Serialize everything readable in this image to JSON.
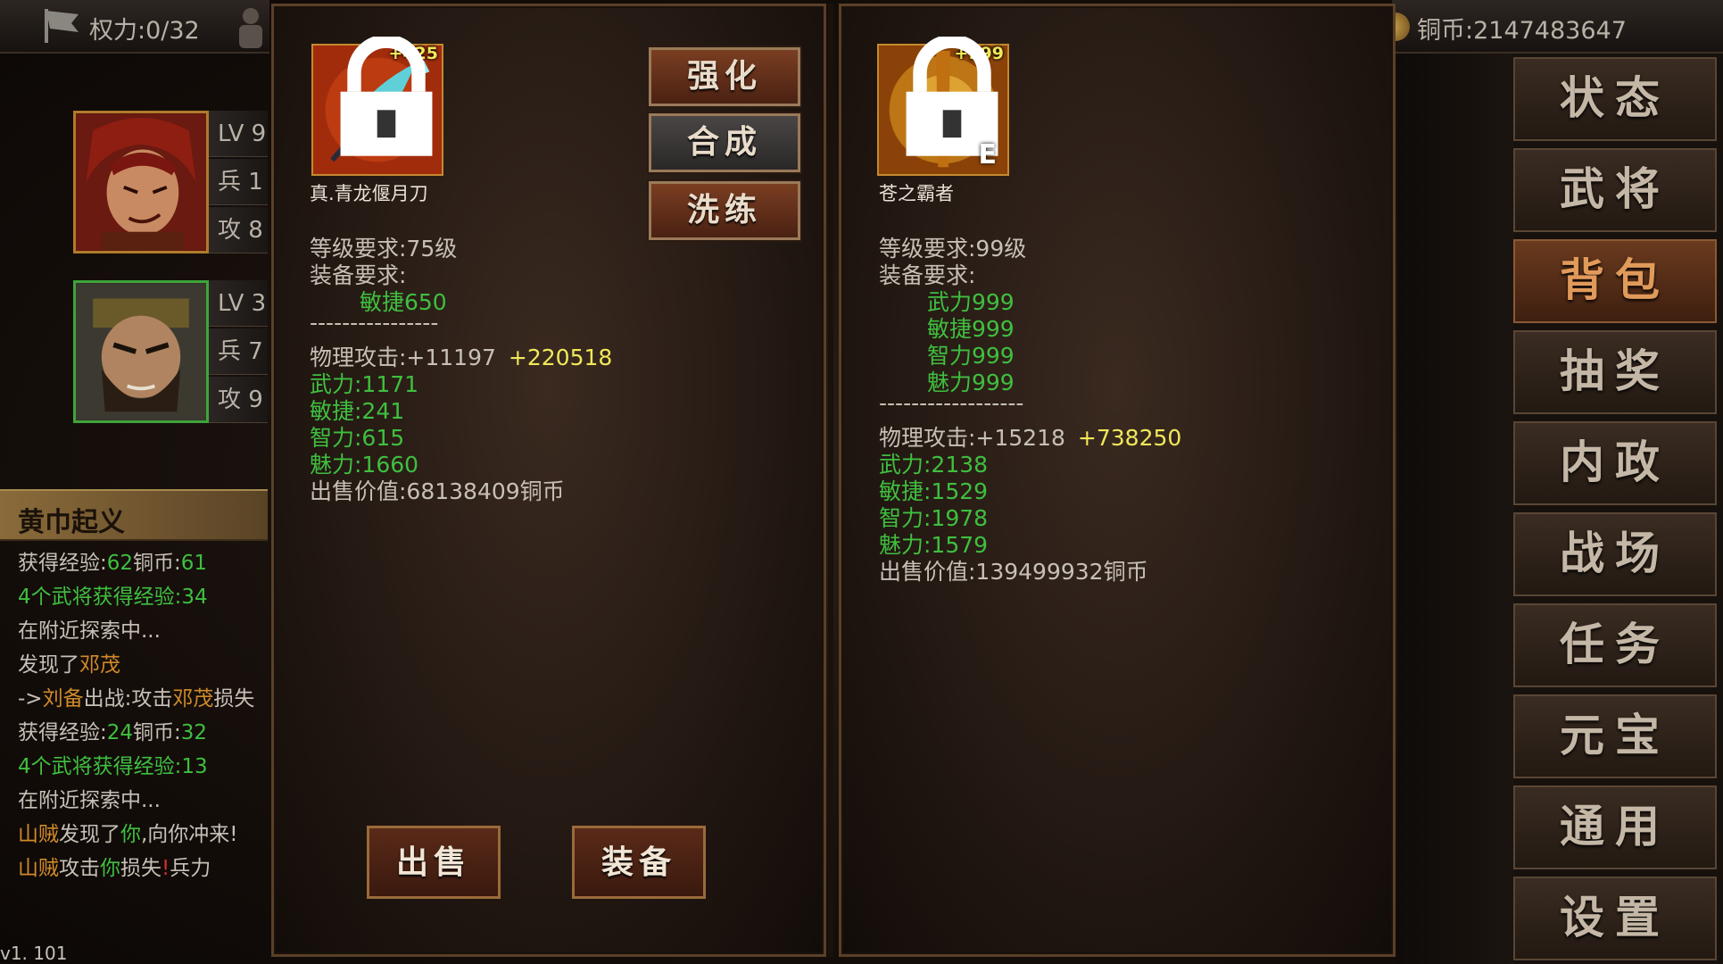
{
  "header": {
    "power_text": "权力:0/32",
    "copper_text": "铜币:2147483647"
  },
  "generals": [
    {
      "rows": [
        "LV 9",
        "兵 1",
        "攻 8"
      ]
    },
    {
      "rows": [
        "LV 3",
        "兵 7",
        "攻 9"
      ]
    }
  ],
  "log": {
    "title": "黄巾起义",
    "lines": [
      [
        {
          "t": "获得经验:",
          "c": "white"
        },
        {
          "t": "62",
          "c": "green"
        },
        {
          "t": "铜币:",
          "c": "white"
        },
        {
          "t": "61",
          "c": "green"
        }
      ],
      [
        {
          "t": "4个武将获得经验:34",
          "c": "green"
        }
      ],
      [
        {
          "t": "在附近探索中...",
          "c": "white"
        }
      ],
      [
        {
          "t": "发现了",
          "c": "white"
        },
        {
          "t": "邓茂",
          "c": "orange"
        }
      ],
      [
        {
          "t": "->",
          "c": "white"
        },
        {
          "t": "刘备",
          "c": "orange"
        },
        {
          "t": "出战:攻击",
          "c": "white"
        },
        {
          "t": "邓茂",
          "c": "orange"
        },
        {
          "t": "损失",
          "c": "white"
        }
      ],
      [
        {
          "t": "获得经验:",
          "c": "white"
        },
        {
          "t": "24",
          "c": "green"
        },
        {
          "t": "铜币:",
          "c": "white"
        },
        {
          "t": "32",
          "c": "green"
        }
      ],
      [
        {
          "t": "4个武将获得经验:13",
          "c": "green"
        }
      ],
      [
        {
          "t": "在附近探索中...",
          "c": "white"
        }
      ],
      [
        {
          "t": "山贼",
          "c": "orange"
        },
        {
          "t": "发现了",
          "c": "white"
        },
        {
          "t": "你",
          "c": "green"
        },
        {
          "t": ",向你冲来!",
          "c": "white"
        }
      ],
      [
        {
          "t": "山贼",
          "c": "orange"
        },
        {
          "t": "攻击",
          "c": "white"
        },
        {
          "t": "你",
          "c": "green"
        },
        {
          "t": "损失",
          "c": "white"
        },
        {
          "t": "!",
          "c": "red"
        },
        {
          "t": "兵力",
          "c": "white"
        }
      ]
    ]
  },
  "version": "v1. 101",
  "item_a": {
    "plus": "+425",
    "name": "真.青龙偃月刀",
    "level_req": "等级要求:75级",
    "equip_req_label": "装备要求:",
    "reqs": [
      "敏捷650"
    ],
    "divider": "----------------",
    "phys_attack": "物理攻击:+11197",
    "phys_bonus": "+220518",
    "stats": [
      "武力:1171",
      "敏捷:241",
      "智力:615",
      "魅力:1660"
    ],
    "sell_value": "出售价值:68138409铜币"
  },
  "item_b": {
    "plus": "+999",
    "grade": "E",
    "name": "苍之霸者",
    "level_req": "等级要求:99级",
    "equip_req_label": "装备要求:",
    "reqs": [
      "武力999",
      "敏捷999",
      "智力999",
      "魅力999"
    ],
    "divider": "------------------",
    "phys_attack": "物理攻击:+15218",
    "phys_bonus": "+738250",
    "stats": [
      "武力:2138",
      "敏捷:1529",
      "智力:1978",
      "魅力:1579"
    ],
    "sell_value": "出售价值:139499932铜币"
  },
  "actions": {
    "enhance": "强化",
    "synthesize": "合成",
    "refine": "洗练",
    "sell": "出售",
    "equip": "装备"
  },
  "menu": {
    "items": [
      "状态",
      "武将",
      "背包",
      "抽奖",
      "内政",
      "战场",
      "任务",
      "元宝",
      "通用",
      "设置"
    ],
    "active": "背包"
  },
  "colors": {
    "stat_green": "#3fbf3f",
    "bonus_yellow": "#f0e85a",
    "panel_border": "#5a4028",
    "menu_active": "#e09a5a"
  }
}
